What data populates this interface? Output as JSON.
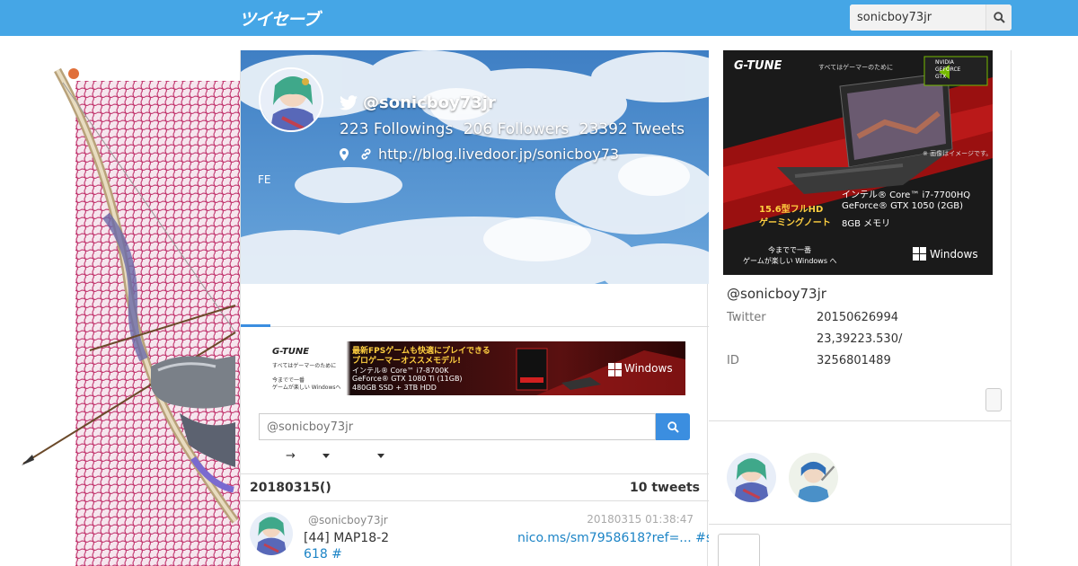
{
  "app": {
    "logo_text": "ツイセーブ"
  },
  "search": {
    "value": "sonicboy73jr"
  },
  "profile": {
    "handle": "@sonicboy73jr",
    "followings": "223 Followings",
    "followers": "206 Followers",
    "tweets": "23392 Tweets",
    "url": "http://blog.livedoor.jp/sonicboy73",
    "bio": "FE"
  },
  "ads": {
    "wide": {
      "brand": "G-TUNE",
      "tagline": "すべてはゲーマーのために",
      "headline1": "最新FPSゲームも快適にプレイできる",
      "headline2": "プロゲーマーオススメモデル!",
      "spec1": "インテル® Core™ i7-8700K",
      "spec2": "GeForce® GTX 1080 Ti (11GB)",
      "spec3": "480GB SSD + 3TB HDD",
      "sub1": "今までで一番",
      "sub2": "ゲームが楽しい Windowsへ",
      "os": "Windows"
    },
    "box": {
      "brand": "G-TUNE",
      "tagline": "すべてはゲーマーのために",
      "badge1": "NVIDIA",
      "badge2": "GEFORCE",
      "badge3": "GTX",
      "note": "※ 画像はイメージです。",
      "size1": "15.6型フルHD",
      "size2": "ゲーミングノート",
      "spec1": "インテル® Core™ i7-7700HQ",
      "spec2": "GeForce® GTX 1050 (2GB)",
      "spec3": "8GB メモリ",
      "sub1": "今までで一番",
      "sub2": "ゲームが楽しい Windows へ",
      "os": "Windows"
    }
  },
  "filter": {
    "placeholder": "@sonicboy73jr"
  },
  "sort": {
    "arrow": "→"
  },
  "day": {
    "date": "20180315()",
    "count": "10 tweets"
  },
  "tweet": {
    "user": "@sonicboy73jr",
    "time": "20180315 01:38:47",
    "text": "[44]  MAP18-2",
    "link": "nico.ms/sm7958618?ref=... #s",
    "line2": "618 #"
  },
  "side": {
    "handle": "@sonicboy73jr",
    "info": [
      {
        "key": "Twitter",
        "value": "20150626994"
      },
      {
        "key": "",
        "value": "23,39223.530/"
      },
      {
        "key": "ID",
        "value": "3256801489"
      }
    ]
  },
  "colors": {
    "topbar": "#45a6e6",
    "accent": "#3b8ee0",
    "link": "#1c84c6"
  }
}
